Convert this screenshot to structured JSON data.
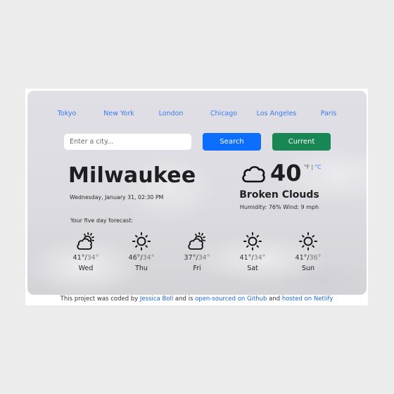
{
  "cities": [
    "Tokyo",
    "New York",
    "London",
    "Chicago",
    "Los Angeles",
    "Paris"
  ],
  "search": {
    "placeholder": "Enter a city...",
    "value": ""
  },
  "buttons": {
    "search": "Search",
    "current": "Current"
  },
  "current": {
    "city": "Milwaukee",
    "date": "Wednesday, January 31, 02:30 PM",
    "icon": "cloud-icon",
    "temperature": "40",
    "unit_f": "°F",
    "separator": "|",
    "unit_c": "°C",
    "description": "Broken Clouds",
    "details": "Humidity: 76% Wind: 9 mph"
  },
  "forecast": {
    "title": "Your five day forecast:",
    "days": [
      {
        "day": "Wed",
        "high": "41°",
        "low": "34°",
        "icon": "partly-cloudy-icon"
      },
      {
        "day": "Thu",
        "high": "46°",
        "low": "34°",
        "icon": "sun-icon"
      },
      {
        "day": "Fri",
        "high": "37°",
        "low": "34°",
        "icon": "partly-cloudy-icon"
      },
      {
        "day": "Sat",
        "high": "41°",
        "low": "34°",
        "icon": "sun-icon"
      },
      {
        "day": "Sun",
        "high": "41°",
        "low": "36°",
        "icon": "sun-icon"
      }
    ]
  },
  "footer": {
    "text1": "This project was coded by ",
    "author": "Jessica Boll",
    "text2": " and is ",
    "github": "open-sourced on Github",
    "text3": " and ",
    "netlify": "hosted on Netlify"
  },
  "colors": {
    "link": "#3d7af0",
    "search_button": "#0d6efd",
    "current_button": "#198754"
  }
}
